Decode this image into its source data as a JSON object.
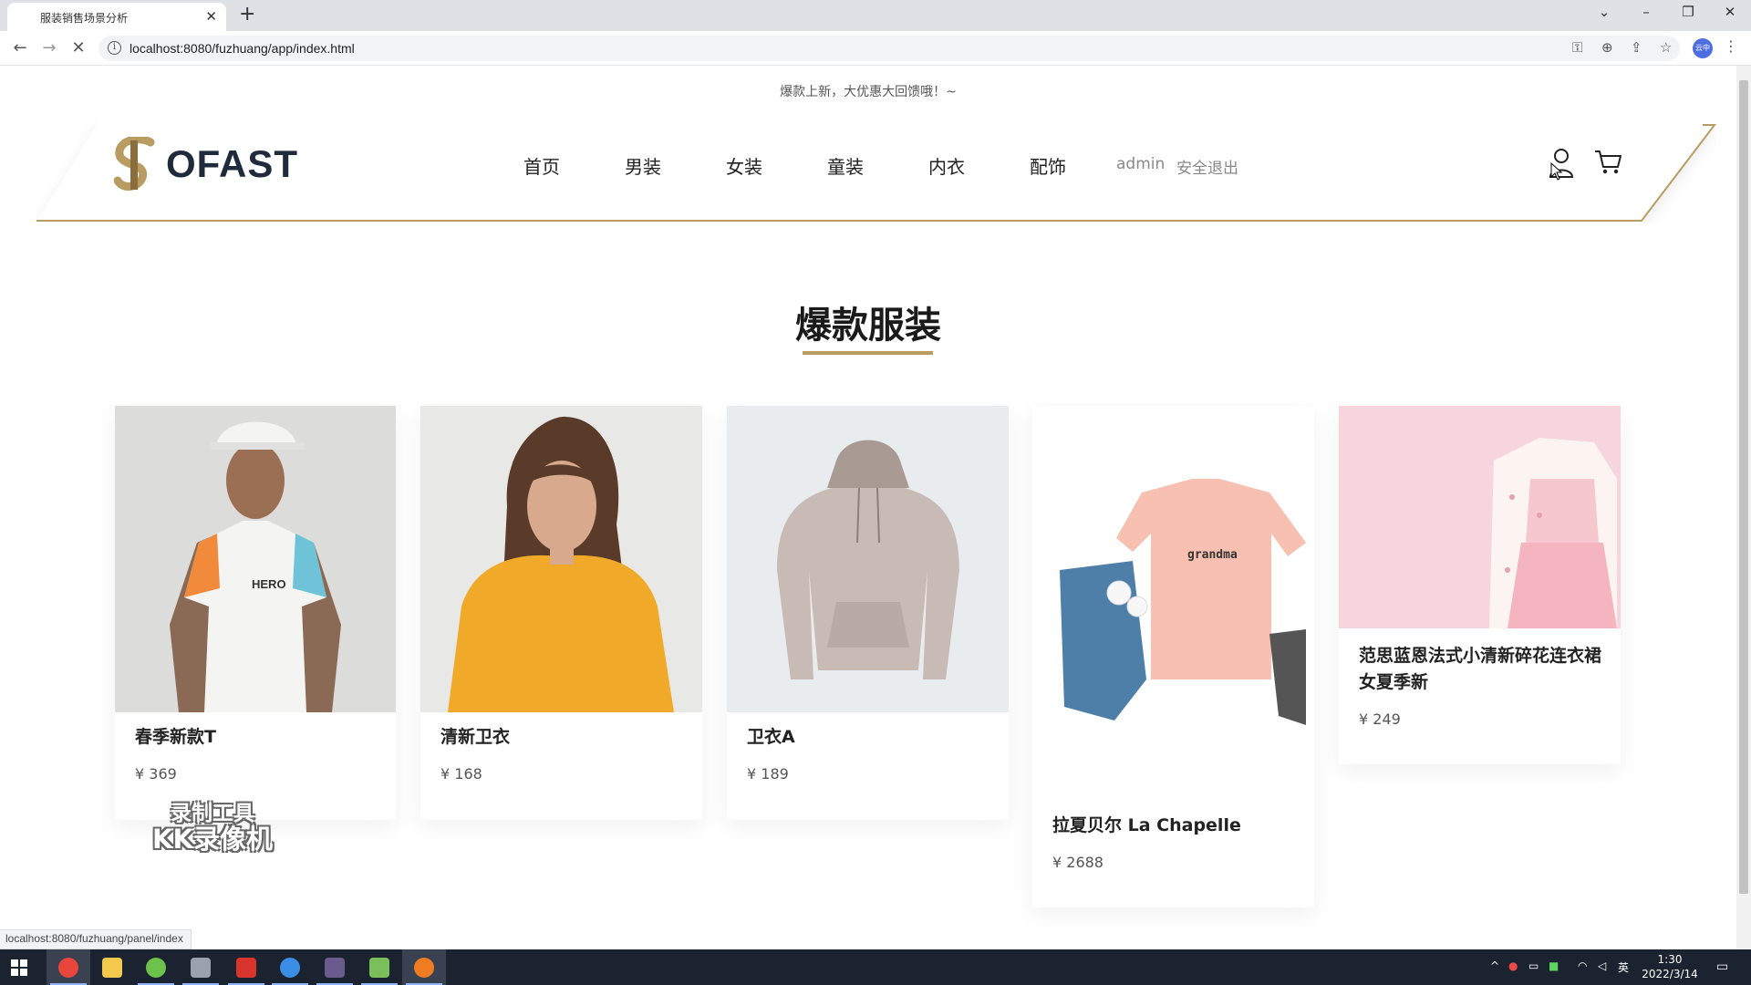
{
  "browser": {
    "tab_title": "服装销售场景分析",
    "tab_close": "✕",
    "new_tab": "+",
    "url": "localhost:8080/fuzhuang/app/index.html",
    "status_url": "localhost:8080/fuzhuang/panel/index",
    "profile_label": "云中"
  },
  "site": {
    "notice": "爆款上新，大优惠大回馈哦！~",
    "logo_text": "OFAST",
    "accent_color": "#b89c62",
    "nav": [
      "首页",
      "男装",
      "女装",
      "童装",
      "内衣",
      "配饰"
    ],
    "username": "admin",
    "logout": "安全退出"
  },
  "section": {
    "title": "爆款服装"
  },
  "products": [
    {
      "name": "春季新款T",
      "price": "¥  369",
      "image": "man-in-white-tshirt-with-cap"
    },
    {
      "name": "清新卫衣",
      "price": "¥  168",
      "image": "woman-in-yellow-sweater"
    },
    {
      "name": "卫衣A",
      "price": "¥  189",
      "image": "beige-hoodie"
    },
    {
      "name": "拉夏贝尔 La Chapelle",
      "price": "¥  2688",
      "image": "pink-grandma-tshirt-with-jeans"
    },
    {
      "name": "范思蓝恩法式小清新碎花连衣裙女夏季新",
      "price": "¥  249",
      "image": "pink-girls-dress-with-cardigan"
    }
  ],
  "watermark": {
    "line1": "录制工具",
    "line2": "KK录像机"
  },
  "taskbar": {
    "time": "1:30",
    "date": "2022/3/14",
    "ime": "英"
  }
}
